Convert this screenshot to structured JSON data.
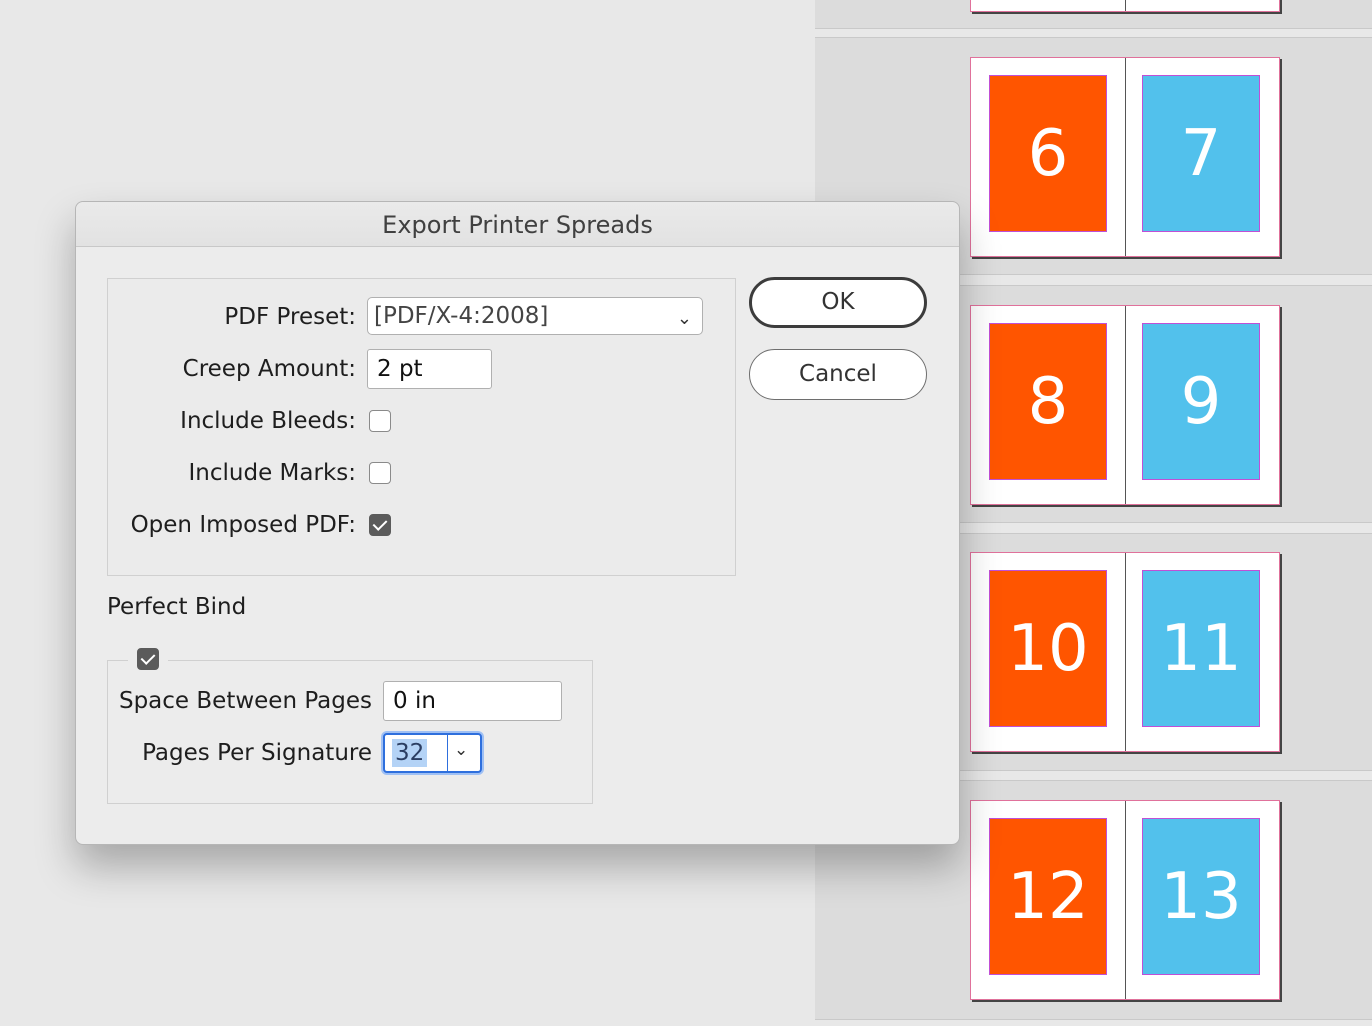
{
  "dialog": {
    "title": "Export Printer Spreads",
    "pdf_preset": {
      "label": "PDF Preset:",
      "value": "[PDF/X-4:2008]"
    },
    "creep_amount": {
      "label": "Creep Amount:",
      "value": "2 pt"
    },
    "include_bleeds": {
      "label": "Include Bleeds:",
      "checked": false
    },
    "include_marks": {
      "label": "Include Marks:",
      "checked": false
    },
    "open_imposed_pdf": {
      "label": "Open Imposed PDF:",
      "checked": true
    },
    "ok_label": "OK",
    "cancel_label": "Cancel",
    "perfect_bind": {
      "title": "Perfect Bind",
      "enabled": true,
      "space_between_pages": {
        "label": "Space Between Pages",
        "value": "0 in"
      },
      "pages_per_signature": {
        "label": "Pages Per Signature",
        "value": "32"
      }
    }
  },
  "pages_panel": {
    "spreads": [
      {
        "left": "6",
        "right": "7"
      },
      {
        "left": "8",
        "right": "9"
      },
      {
        "left": "10",
        "right": "11"
      },
      {
        "left": "12",
        "right": "13"
      }
    ],
    "colors": {
      "left_page": "#ff5500",
      "right_page": "#52c1ec"
    }
  }
}
